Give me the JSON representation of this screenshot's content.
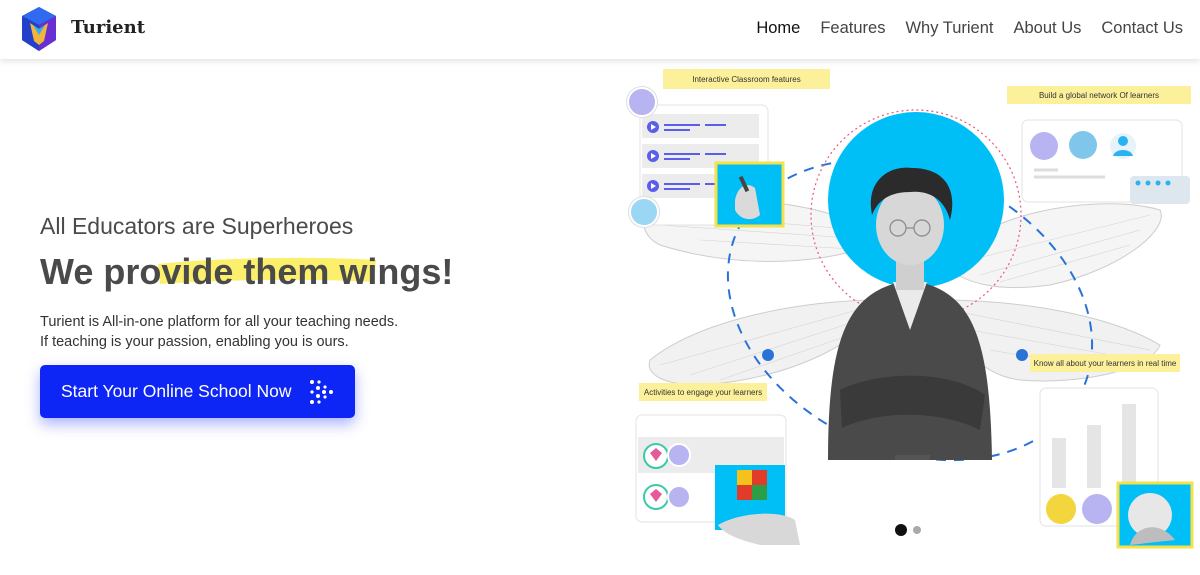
{
  "header": {
    "brand": "Turient",
    "nav": [
      {
        "label": "Home",
        "active": true
      },
      {
        "label": "Features",
        "active": false
      },
      {
        "label": "Why Turient",
        "active": false
      },
      {
        "label": "About Us",
        "active": false
      },
      {
        "label": "Contact Us",
        "active": false
      }
    ]
  },
  "hero": {
    "eyebrow": "All Educators are Superheroes",
    "headline": "We provide them wings!",
    "description_line1": "Turient is All-in-one platform for all your teaching needs.",
    "description_line2": "If teaching is your passion, enabling you is ours.",
    "cta_label": "Start Your Online School Now"
  },
  "illustration": {
    "tags": {
      "classroom": "Interactive Classroom features",
      "network": "Build a global network Of learners",
      "activities": "Activities to engage your learners",
      "realtime": "Know all about your learners in real time"
    }
  },
  "carousel": {
    "slide_count": 2,
    "active_slide": 1
  },
  "colors": {
    "accent": "#0d26f5",
    "highlight": "#fcef6b",
    "tag": "#fcf19a",
    "sky": "#00bff6"
  }
}
